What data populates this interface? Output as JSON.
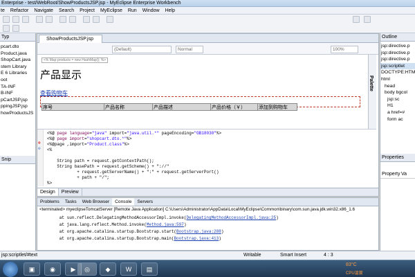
{
  "window": {
    "title": "Enterprise - test/WebRoot/ShowProductsJSP.jsp - MyEclipse Enterprise Workbench"
  },
  "menu": [
    "File",
    "Refactor",
    "Navigate",
    "Search",
    "Project",
    "MyEclipse",
    "Run",
    "Window",
    "Help"
  ],
  "menu_visible": [
    "te",
    "Refactor",
    "Navigate",
    "Search",
    "Project",
    "MyEclipse",
    "Run",
    "Window",
    "Help"
  ],
  "left": {
    "tab": "Typ",
    "items": [
      "pcart.dto",
      "Product.java",
      "ShopCart.java",
      "stem Library",
      "E 6 Libraries",
      "oot",
      "TA-INF",
      "B-INF",
      "pCartJSP.jsp",
      "ppingJSP.jsp",
      "howProductsJS"
    ],
    "snip": "Snip"
  },
  "editor": {
    "tab": "ShowProductsJSP.jsp",
    "font": "(Default)",
    "style": "Normal",
    "zoom": "100%",
    "design_hint": "<% Map products = new HashMap(); %>",
    "heading": "产品显示",
    "link": "查看购物车",
    "table_headers": [
      "序号",
      "产品名称",
      "产品描述",
      "产品价格（￥）",
      "添加到购物车"
    ],
    "palette": "Palette"
  },
  "source_lines": [
    {
      "parts": [
        [
          "<%@ ",
          ""
        ],
        [
          "page language",
          "kw"
        ],
        [
          "=",
          ""
        ],
        [
          "\"java\"",
          "str"
        ],
        [
          " import=",
          ""
        ],
        [
          "\"java.util.*\"",
          "str"
        ],
        [
          " pageEncoding=",
          ""
        ],
        [
          "\"GB18030\"",
          "str"
        ],
        [
          "%>",
          ""
        ]
      ]
    },
    {
      "parts": [
        [
          "<%@ ",
          ""
        ],
        [
          "page import",
          "kw"
        ],
        [
          "=",
          ""
        ],
        [
          "\"shopcart.dto.*\"",
          "str"
        ],
        [
          "%>",
          ""
        ]
      ]
    },
    {
      "parts": [
        [
          "<%@page ,import=",
          ""
        ],
        [
          "\"Product.class\"",
          "str"
        ],
        [
          "%>",
          ""
        ]
      ]
    },
    {
      "parts": [
        [
          "<%",
          ""
        ]
      ]
    },
    {
      "parts": [
        [
          "",
          ""
        ]
      ]
    },
    {
      "parts": [
        [
          "    String path = request.getContextPath();",
          ""
        ]
      ]
    },
    {
      "parts": [
        [
          "    String basePath = request.getScheme() + \"://\"",
          ""
        ]
      ]
    },
    {
      "parts": [
        [
          "            + request.getServerName() + \":\" + request.getServerPort()",
          ""
        ]
      ]
    },
    {
      "parts": [
        [
          "            + path + \"/\";",
          ""
        ]
      ]
    },
    {
      "parts": [
        [
          "%>",
          ""
        ]
      ]
    }
  ],
  "views": {
    "design": "Design",
    "preview": "Preview"
  },
  "console": {
    "tabs": [
      "Problems",
      "Tasks",
      "Web Browser",
      "Console",
      "Servers"
    ],
    "terminated": "<terminated> myeclipseTomcatServer [Remote Java Application] C:\\Users\\Administrator\\AppData\\Local\\MyEclipse\\Common\\binary\\com.sun.java.jdk.win32.x86_1.6",
    "lines": [
      {
        "pre": "        at sun.reflect.DelegatingMethodAccessorImpl.invoke(",
        "link": "DelegatingMethodAccessorImpl.java:25",
        "post": ")"
      },
      {
        "pre": "        at java.lang.reflect.Method.invoke(",
        "link": "Method.java:597",
        "post": ")"
      },
      {
        "pre": "        at org.apache.catalina.startup.Bootstrap.start(",
        "link": "Bootstrap.java:288",
        "post": ")"
      },
      {
        "pre": "        at org.apache.catalina.startup.Bootstrap.main(",
        "link": "Bootstrap.java:413",
        "post": ")"
      }
    ]
  },
  "right": {
    "outline": "Outline",
    "items": [
      "jsp:directive.p",
      "jsp:directive.p",
      "jsp:directive.p",
      "jsp:scriptlet",
      "DOCTYPE:HTM",
      "html",
      "head",
      "body bgcol",
      "jsp:sc",
      "H1",
      "a href=#",
      "form ac"
    ],
    "properties": "Properties",
    "property": "Property",
    "value": "Va"
  },
  "status": {
    "path": "jsp:scriptlet/#text",
    "writable": "Writable",
    "insert": "Smart Insert",
    "pos": "4 : 3"
  },
  "taskbar": {
    "temp": "83°C",
    "cpu": "CPU温度"
  }
}
